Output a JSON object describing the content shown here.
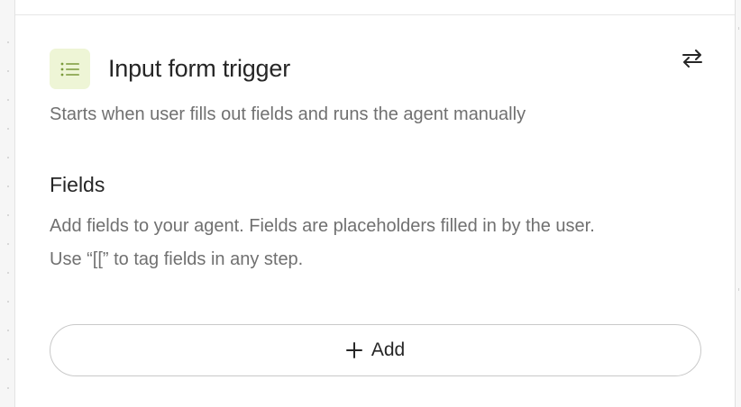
{
  "panel": {
    "title": "Input form trigger",
    "icon": "list-icon",
    "swap_icon": "swap-arrows-icon",
    "description": "Starts when user fills out fields and runs the agent manually"
  },
  "fields_section": {
    "heading": "Fields",
    "text_line1": "Add fields to your agent. Fields are placeholders filled in by the user.",
    "text_line2": "Use “[[” to tag fields in any step."
  },
  "add_button": {
    "icon": "plus-icon",
    "label": "Add"
  },
  "colors": {
    "icon_bg": "#eef5d6",
    "icon_fg": "#7a9a3a",
    "title": "#262626",
    "muted_text": "#707070",
    "border": "#c9c9c9"
  }
}
